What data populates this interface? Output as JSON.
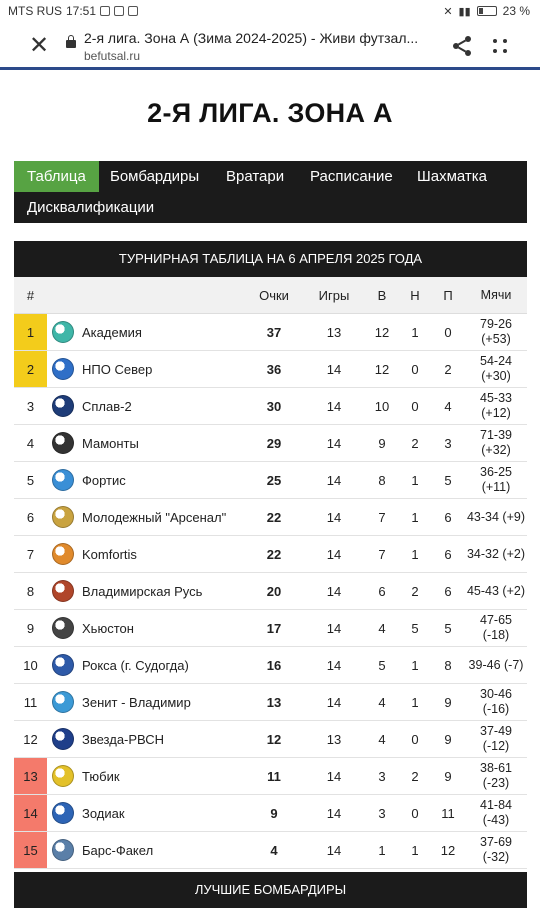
{
  "status_bar": {
    "carrier": "MTS RUS",
    "time": "17:51",
    "battery": "23 %"
  },
  "browser": {
    "page_title": "2-я лига. Зона А (Зима 2024-2025) - Живи футзал...",
    "domain": "befutsal.ru",
    "accent_color": "#2c4a8a"
  },
  "page": {
    "heading": "2-Я ЛИГА. ЗОНА А"
  },
  "tabs": [
    {
      "label": "Таблица",
      "active": true
    },
    {
      "label": "Бомбардиры",
      "active": false
    },
    {
      "label": "Вратари",
      "active": false
    },
    {
      "label": "Расписание",
      "active": false
    },
    {
      "label": "Шахматка",
      "active": false
    },
    {
      "label": "Дисквалификации",
      "active": false
    }
  ],
  "table": {
    "caption": "ТУРНИРНАЯ ТАБЛИЦА НА 6 АПРЕЛЯ 2025 ГОДА",
    "headers": {
      "pos": "#",
      "points": "Очки",
      "games": "Игры",
      "wins": "В",
      "draws": "Н",
      "losses": "П",
      "goals": "Мячи"
    },
    "rows": [
      {
        "pos": "1",
        "team": "Академия",
        "points": "37",
        "games": "13",
        "wins": "12",
        "draws": "1",
        "losses": "0",
        "goals": "79-26",
        "diff": "(+53)",
        "zone": "promo",
        "logo_color": "#3fb6a8"
      },
      {
        "pos": "2",
        "team": "НПО Север",
        "points": "36",
        "games": "14",
        "wins": "12",
        "draws": "0",
        "losses": "2",
        "goals": "54-24",
        "diff": "(+30)",
        "zone": "promo",
        "logo_color": "#2f6fc7"
      },
      {
        "pos": "3",
        "team": "Сплав-2",
        "points": "30",
        "games": "14",
        "wins": "10",
        "draws": "0",
        "losses": "4",
        "goals": "45-33",
        "diff": "(+12)",
        "zone": "",
        "logo_color": "#1e3c78"
      },
      {
        "pos": "4",
        "team": "Мамонты",
        "points": "29",
        "games": "14",
        "wins": "9",
        "draws": "2",
        "losses": "3",
        "goals": "71-39",
        "diff": "(+32)",
        "zone": "",
        "logo_color": "#333333"
      },
      {
        "pos": "5",
        "team": "Фортис",
        "points": "25",
        "games": "14",
        "wins": "8",
        "draws": "1",
        "losses": "5",
        "goals": "36-25",
        "diff": "(+11)",
        "zone": "",
        "logo_color": "#3a8fd6"
      },
      {
        "pos": "6",
        "team": "Молодежный \"Арсенал\"",
        "points": "22",
        "games": "14",
        "wins": "7",
        "draws": "1",
        "losses": "6",
        "goals": "43-34 (+9)",
        "diff": "",
        "zone": "",
        "logo_color": "#c9a340"
      },
      {
        "pos": "7",
        "team": "Komfortis",
        "points": "22",
        "games": "14",
        "wins": "7",
        "draws": "1",
        "losses": "6",
        "goals": "34-32 (+2)",
        "diff": "",
        "zone": "",
        "logo_color": "#e08a2c"
      },
      {
        "pos": "8",
        "team": "Владимирская Русь",
        "points": "20",
        "games": "14",
        "wins": "6",
        "draws": "2",
        "losses": "6",
        "goals": "45-43 (+2)",
        "diff": "",
        "zone": "",
        "logo_color": "#b0462a"
      },
      {
        "pos": "9",
        "team": "Хьюстон",
        "points": "17",
        "games": "14",
        "wins": "4",
        "draws": "5",
        "losses": "5",
        "goals": "47-65",
        "diff": "(-18)",
        "zone": "",
        "logo_color": "#444444"
      },
      {
        "pos": "10",
        "team": "Рокса (г. Судогда)",
        "points": "16",
        "games": "14",
        "wins": "5",
        "draws": "1",
        "losses": "8",
        "goals": "39-46 (-7)",
        "diff": "",
        "zone": "",
        "logo_color": "#2e5aa8"
      },
      {
        "pos": "11",
        "team": "Зенит - Владимир",
        "points": "13",
        "games": "14",
        "wins": "4",
        "draws": "1",
        "losses": "9",
        "goals": "30-46",
        "diff": "(-16)",
        "zone": "",
        "logo_color": "#3c9ad6"
      },
      {
        "pos": "12",
        "team": "Звезда-РВСН",
        "points": "12",
        "games": "13",
        "wins": "4",
        "draws": "0",
        "losses": "9",
        "goals": "37-49",
        "diff": "(-12)",
        "zone": "",
        "logo_color": "#1f3f8a"
      },
      {
        "pos": "13",
        "team": "Тюбик",
        "points": "11",
        "games": "14",
        "wins": "3",
        "draws": "2",
        "losses": "9",
        "goals": "38-61",
        "diff": "(-23)",
        "zone": "releg",
        "logo_color": "#e3c12a"
      },
      {
        "pos": "14",
        "team": "Зодиак",
        "points": "9",
        "games": "14",
        "wins": "3",
        "draws": "0",
        "losses": "11",
        "goals": "41-84",
        "diff": "(-43)",
        "zone": "releg",
        "logo_color": "#2d64b5"
      },
      {
        "pos": "15",
        "team": "Барс-Факел",
        "points": "4",
        "games": "14",
        "wins": "1",
        "draws": "1",
        "losses": "12",
        "goals": "37-69",
        "diff": "(-32)",
        "zone": "releg",
        "logo_color": "#5a7fa8"
      }
    ]
  },
  "next_section": {
    "caption": "ЛУЧШИЕ БОМБАРДИРЫ"
  },
  "colors": {
    "tab_active": "#57a343",
    "dark_bg": "#1b1b1b",
    "promo": "#f3cc1b",
    "releg": "#f47a6b"
  }
}
